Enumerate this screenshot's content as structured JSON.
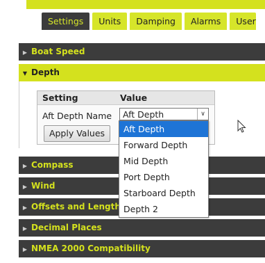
{
  "tabs": [
    {
      "label": "Settings",
      "active": true
    },
    {
      "label": "Units",
      "active": false
    },
    {
      "label": "Damping",
      "active": false
    },
    {
      "label": "Alarms",
      "active": false
    },
    {
      "label": "User",
      "active": false
    }
  ],
  "sections": {
    "boat_speed": "Boat Speed",
    "depth": "Depth",
    "compass": "Compass",
    "wind": "Wind",
    "offsets": "Offsets and Length",
    "decimal": "Decimal Places",
    "nmea": "NMEA 2000 Compatibility"
  },
  "depth_table": {
    "col_setting": "Setting",
    "col_value": "Value",
    "row_label": "Aft Depth Name",
    "select_value": "Aft Depth",
    "apply_label": "Apply Values"
  },
  "dropdown_options": [
    "Aft Depth",
    "Forward Depth",
    "Mid Depth",
    "Port Depth",
    "Starboard Depth",
    "Depth 2"
  ],
  "selected_option_index": 0,
  "colors": {
    "accent": "#d4e11e",
    "dark": "#3c3c3c",
    "highlight": "#1e74d6"
  }
}
